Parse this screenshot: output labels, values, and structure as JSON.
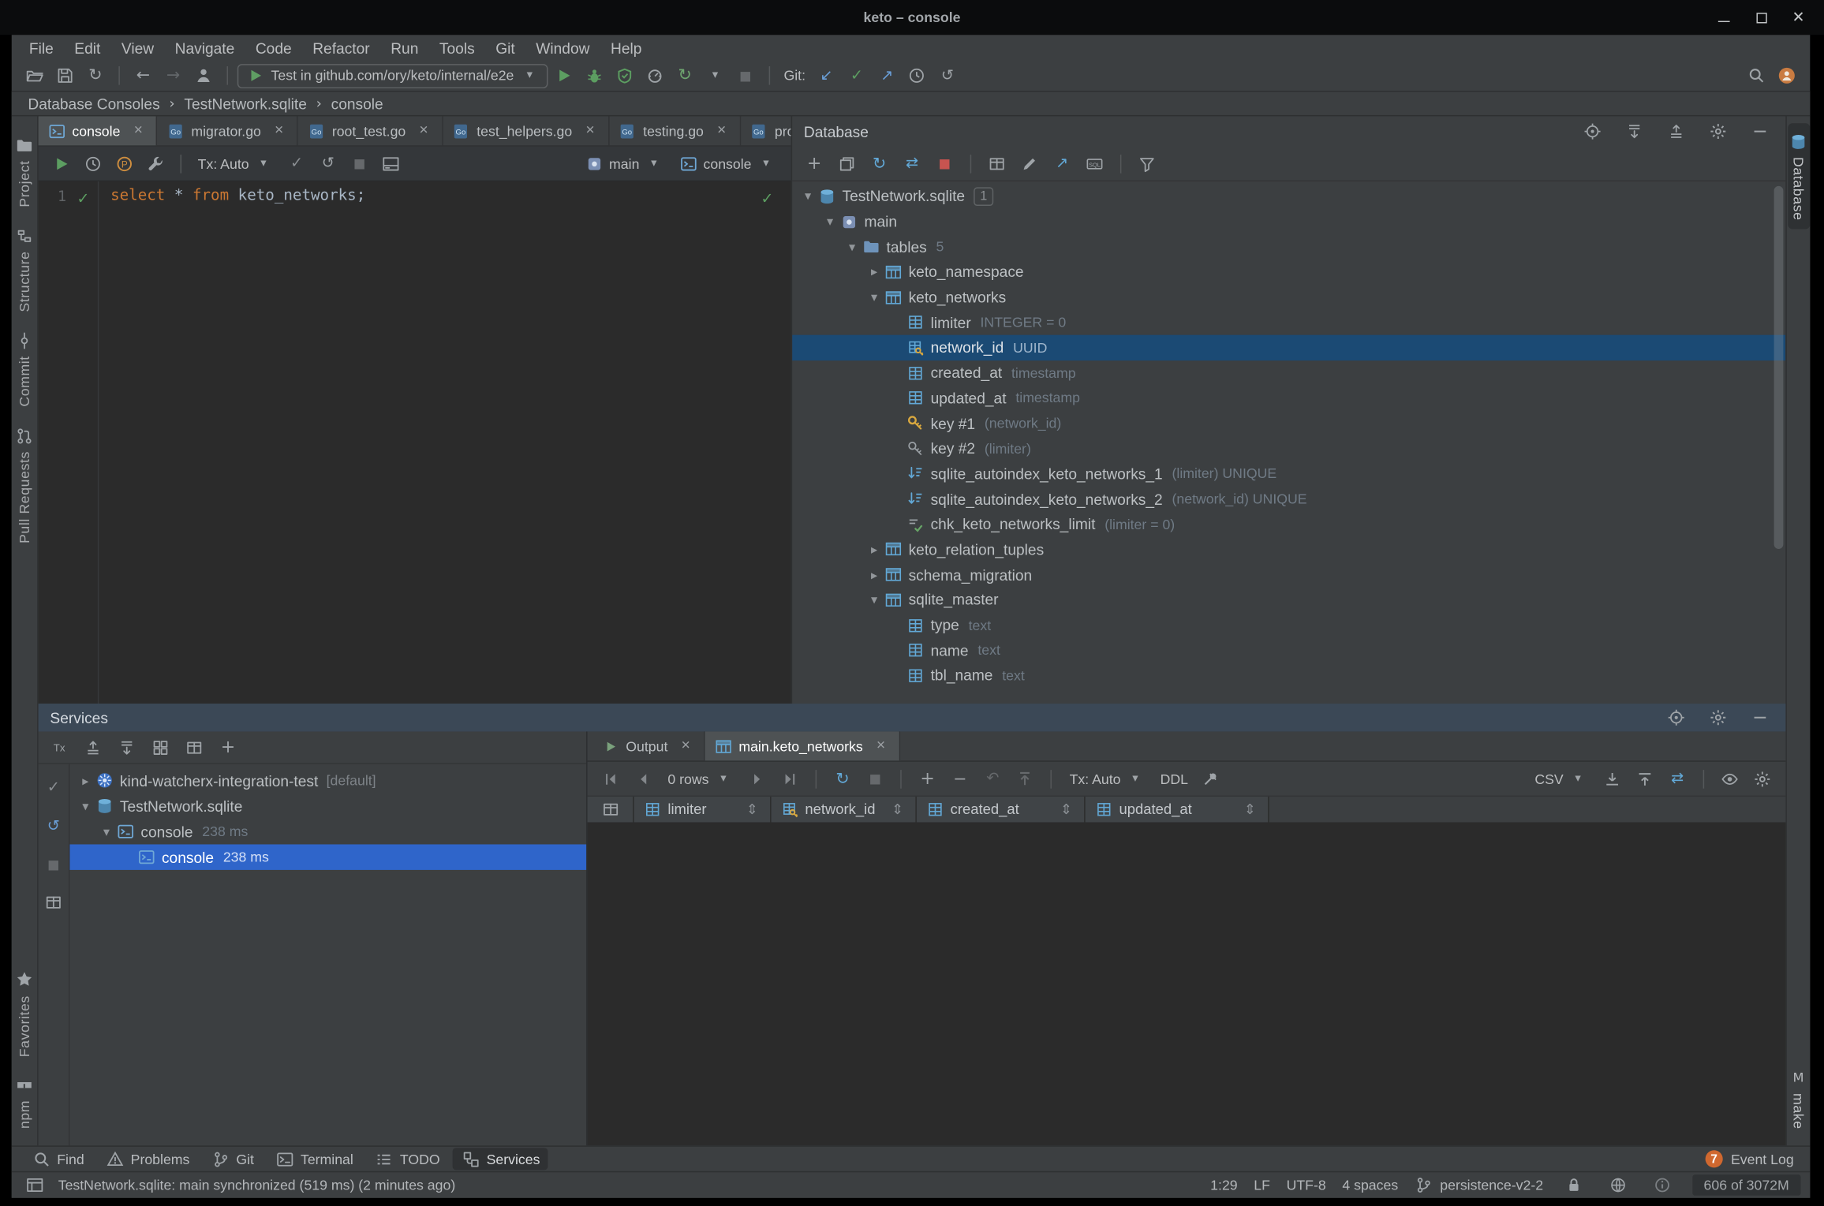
{
  "window": {
    "title": "keto – console"
  },
  "menubar": [
    "File",
    "Edit",
    "View",
    "Navigate",
    "Code",
    "Refactor",
    "Run",
    "Tools",
    "Git",
    "Window",
    "Help"
  ],
  "main_toolbar": {
    "file_icons": [
      "open",
      "save",
      "sync"
    ],
    "nav_icons": [
      "back",
      "forward"
    ],
    "user_icon": "user",
    "run_config": {
      "icon": "test-green",
      "label": "Test in github.com/ory/keto/internal/e2e"
    },
    "run_icons": [
      "run",
      "debug",
      "coverage",
      "profiler",
      "rerun"
    ],
    "stop_icon": "stop-grey",
    "git_label": "Git:",
    "git_icons": [
      "git-update",
      "git-commit",
      "git-push",
      "history",
      "rollback"
    ],
    "right_icons": [
      "search",
      "avatar"
    ]
  },
  "breadcrumbs": [
    "Database Consoles",
    "TestNetwork.sqlite",
    "console"
  ],
  "left_stripe": {
    "top": [
      {
        "label": "Project",
        "icon": "project"
      },
      {
        "label": "Structure",
        "icon": "structure"
      },
      {
        "label": "Commit",
        "icon": "commit"
      },
      {
        "label": "Pull Requests",
        "icon": "pull-requests"
      }
    ],
    "bottom": [
      {
        "label": "Favorites",
        "icon": "star"
      },
      {
        "label": "npm",
        "icon": "npm"
      }
    ]
  },
  "right_stripe": {
    "top": [
      {
        "label": "Database",
        "icon": "db"
      }
    ],
    "bottom": [
      {
        "label": "make",
        "icon": "m-letter"
      }
    ]
  },
  "editor": {
    "tabs": [
      {
        "label": "console",
        "icon": "console-file",
        "active": true
      },
      {
        "label": "migrator.go",
        "icon": "go-file"
      },
      {
        "label": "root_test.go",
        "icon": "go-file"
      },
      {
        "label": "test_helpers.go",
        "icon": "go-file"
      },
      {
        "label": "testing.go",
        "icon": "go-file"
      },
      {
        "label": "prov",
        "icon": "go-file"
      }
    ],
    "toolbar": {
      "left_icons": [
        "run",
        "history",
        "explain-plan",
        "wrench"
      ],
      "tx_label": "Tx: Auto",
      "state_icons": [
        "check-grey",
        "rollback",
        "stop-grey",
        "output"
      ],
      "schema_label": "main",
      "session_label": "console"
    },
    "line_number": "1",
    "code": [
      {
        "text": "select",
        "type": "keyword"
      },
      {
        "text": " * ",
        "type": "plain"
      },
      {
        "text": "from",
        "type": "keyword"
      },
      {
        "text": " keto_networks;",
        "type": "plain"
      }
    ]
  },
  "database_panel": {
    "title": "Database",
    "header_icons": [
      "target",
      "expand-all",
      "collapse-all",
      "settings",
      "hide"
    ],
    "toolbar_icons": [
      "add",
      "duplicate",
      "refresh-blue",
      "compare-blue",
      "stop-red",
      "grid-small",
      "edit",
      "navigate",
      "ddl",
      "filter"
    ],
    "tree": [
      {
        "label": "TestNetwork.sqlite",
        "badge": "1",
        "icon": "db",
        "level": 0,
        "chevron": "open"
      },
      {
        "label": "main",
        "icon": "schema",
        "level": 1,
        "chevron": "open"
      },
      {
        "label": "tables",
        "count": "5",
        "icon": "folder",
        "level": 2,
        "chevron": "open"
      },
      {
        "label": "keto_namespace",
        "icon": "table",
        "level": 3,
        "chevron": "closed"
      },
      {
        "label": "keto_networks",
        "icon": "table",
        "level": 3,
        "chevron": "open"
      },
      {
        "label": "limiter",
        "hint": "INTEGER = 0",
        "icon": "column",
        "level": 4
      },
      {
        "label": "network_id",
        "hint": "UUID",
        "icon": "column-key",
        "level": 4,
        "selected": true
      },
      {
        "label": "created_at",
        "hint": "timestamp",
        "icon": "column",
        "level": 4
      },
      {
        "label": "updated_at",
        "hint": "timestamp",
        "icon": "column",
        "level": 4
      },
      {
        "label": "key #1",
        "hint": "(network_id)",
        "icon": "key-gold",
        "level": 4
      },
      {
        "label": "key #2",
        "hint": "(limiter)",
        "icon": "key-grey",
        "level": 4
      },
      {
        "label": "sqlite_autoindex_keto_networks_1",
        "hint": "(limiter) UNIQUE",
        "icon": "index",
        "level": 4
      },
      {
        "label": "sqlite_autoindex_keto_networks_2",
        "hint": "(network_id) UNIQUE",
        "icon": "index",
        "level": 4
      },
      {
        "label": "chk_keto_networks_limit",
        "hint": "(limiter = 0)",
        "icon": "check-constraint",
        "level": 4
      },
      {
        "label": "keto_relation_tuples",
        "icon": "table",
        "level": 3,
        "chevron": "closed"
      },
      {
        "label": "schema_migration",
        "icon": "table",
        "level": 3,
        "chevron": "closed"
      },
      {
        "label": "sqlite_master",
        "icon": "table",
        "level": 3,
        "chevron": "open"
      },
      {
        "label": "type",
        "hint": "text",
        "icon": "column",
        "level": 4
      },
      {
        "label": "name",
        "hint": "text",
        "icon": "column",
        "level": 4
      },
      {
        "label": "tbl_name",
        "hint": "text",
        "icon": "column",
        "level": 4
      }
    ]
  },
  "services": {
    "title": "Services",
    "header_icons": [
      "target",
      "settings",
      "hide"
    ],
    "toolbar_icons": [
      "tx",
      "collapse-all",
      "expand-all",
      "group",
      "grid-small",
      "add"
    ],
    "side_icons": [
      "check-grey",
      "rollback-blue",
      "stop-grey",
      "grid-small"
    ],
    "tree": [
      {
        "label": "kind-watcherx-integration-test",
        "suffix": "[default]",
        "icon": "kubernetes",
        "level": 0,
        "chevron": "closed"
      },
      {
        "label": "TestNetwork.sqlite",
        "icon": "db",
        "level": 0,
        "chevron": "open"
      },
      {
        "label": "console",
        "hint": "238 ms",
        "icon": "console-file",
        "level": 1,
        "chevron": "open"
      },
      {
        "label": "console",
        "hint": "238 ms",
        "icon": "console-file",
        "level": 2,
        "selected": true
      }
    ],
    "output_tabs": [
      {
        "label": "Output",
        "icon": "run-tab"
      },
      {
        "label": "main.keto_networks",
        "icon": "table",
        "active": true
      }
    ],
    "grid": {
      "pager_label": "0 rows",
      "tx_label": "Tx: Auto",
      "ddl_label": "DDL",
      "csv_label": "CSV",
      "columns": [
        {
          "label": "limiter",
          "icon": "column"
        },
        {
          "label": "network_id",
          "icon": "column-key"
        },
        {
          "label": "created_at",
          "icon": "column"
        },
        {
          "label": "updated_at",
          "icon": "column"
        }
      ]
    }
  },
  "bottom_bar": {
    "items": [
      {
        "label": "Find",
        "icon": "search"
      },
      {
        "label": "Problems",
        "icon": "problems"
      },
      {
        "label": "Git",
        "icon": "git-branch"
      },
      {
        "label": "Terminal",
        "icon": "terminal"
      },
      {
        "label": "TODO",
        "icon": "todo"
      },
      {
        "label": "Services",
        "icon": "services-icon",
        "active": true
      }
    ],
    "event_log": {
      "badge": "7",
      "label": "Event Log"
    }
  },
  "status_bar": {
    "message": "TestNetwork.sqlite: main synchronized (519 ms) (2 minutes ago)",
    "caret": "1:29",
    "line_ending": "LF",
    "encoding": "UTF-8",
    "indent": "4 spaces",
    "branch": "persistence-v2-2",
    "memory": "606 of 3072M"
  }
}
